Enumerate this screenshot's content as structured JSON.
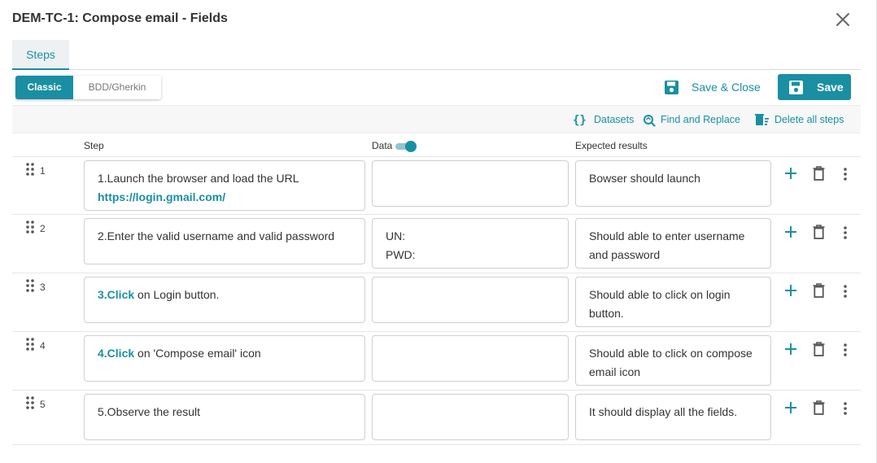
{
  "dialog": {
    "title": "DEM-TC-1: Compose email - Fields"
  },
  "tabs": [
    {
      "label": "Steps"
    }
  ],
  "mode": {
    "classic": "Classic",
    "bdd": "BDD/Gherkin"
  },
  "actions": {
    "save_close": "Save & Close",
    "save": "Save"
  },
  "toolbar": {
    "datasets": "Datasets",
    "find_replace": "Find and Replace",
    "delete_all": "Delete all steps"
  },
  "columns": {
    "step": "Step",
    "data": "Data",
    "expected": "Expected results"
  },
  "data_toggle_on": true,
  "accent_color": "#1a8fa3",
  "steps": [
    {
      "num": "1",
      "step_text": "1.Launch the browser and load the URL",
      "step_link": "https://login.gmail.com/",
      "data_line1": "",
      "data_line2": "",
      "expected": "Bowser should launch"
    },
    {
      "num": "2",
      "step_text": "2.Enter the valid username and valid password",
      "data_line1": "UN:",
      "data_line2": "PWD:",
      "expected": "Should able to enter username and password"
    },
    {
      "num": "3",
      "step_prefix": "3.Click",
      "step_text": " on Login button.",
      "data_line1": "",
      "data_line2": "",
      "expected": "Should able to click on login button."
    },
    {
      "num": "4",
      "step_prefix": "4.Click",
      "step_text": " on 'Compose email' icon",
      "data_line1": "",
      "data_line2": "",
      "expected": "Should able to click on compose email icon"
    },
    {
      "num": "5",
      "step_text": "5.Observe the result",
      "data_line1": "",
      "data_line2": "",
      "expected": "It should display all the fields."
    }
  ]
}
